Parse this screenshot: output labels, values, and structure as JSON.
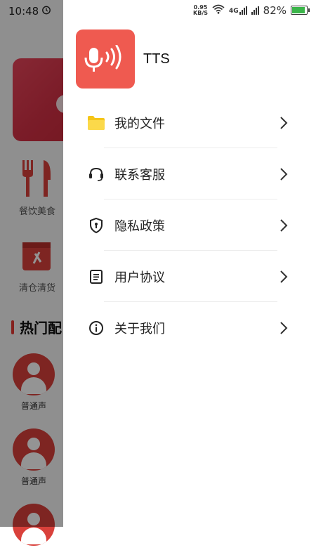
{
  "background": {
    "time": "10:48",
    "categories": [
      {
        "label": "餐饮美食",
        "icon": "fork-knife-icon"
      },
      {
        "label": "清仓清货",
        "icon": "clearance-box-icon"
      }
    ],
    "section_title": "热门配",
    "voices": [
      {
        "label": "普通声"
      },
      {
        "label": "普通声"
      }
    ]
  },
  "status_bar": {
    "speed_value": "0.95",
    "speed_unit": "KB/S",
    "network_label": "4G",
    "battery_percent": "82%",
    "battery_level": 0.82,
    "battery_color": "#3bb54a"
  },
  "drawer": {
    "app_name": "TTS",
    "logo_color": "#ef5a50",
    "menu": [
      {
        "label": "我的文件",
        "icon": "folder-icon"
      },
      {
        "label": "联系客服",
        "icon": "headset-icon"
      },
      {
        "label": "隐私政策",
        "icon": "shield-icon"
      },
      {
        "label": "用户协议",
        "icon": "document-icon"
      },
      {
        "label": "关于我们",
        "icon": "info-icon"
      }
    ]
  }
}
